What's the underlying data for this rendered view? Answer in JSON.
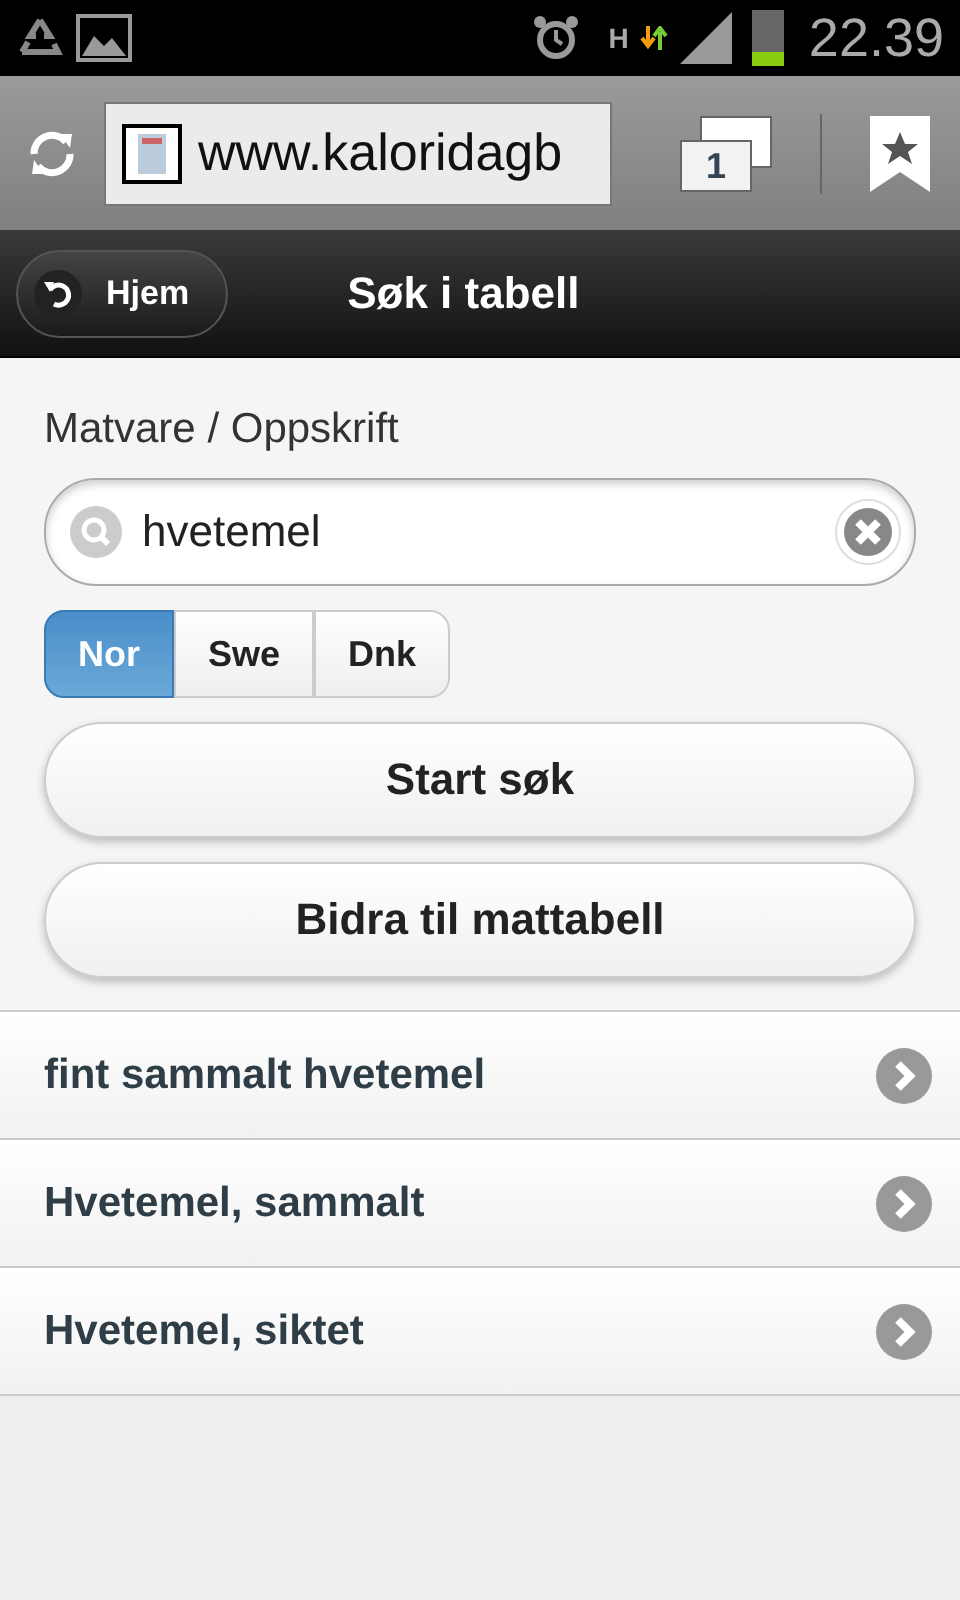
{
  "status_bar": {
    "network": "H",
    "time": "22.39"
  },
  "browser": {
    "url": "www.kaloridagb",
    "tab_count": "1"
  },
  "header": {
    "back": "Hjem",
    "title": "Søk i tabell"
  },
  "form": {
    "label": "Matvare / Oppskrift",
    "search": {
      "value": "hvetemel"
    },
    "segments": [
      {
        "label": "Nor",
        "selected": true
      },
      {
        "label": "Swe",
        "selected": false
      },
      {
        "label": "Dnk",
        "selected": false
      }
    ],
    "buttons": [
      "Start søk",
      "Bidra til mattabell"
    ]
  },
  "results": [
    {
      "label": "fint sammalt hvetemel"
    },
    {
      "label": "Hvetemel, sammalt"
    },
    {
      "label": "Hvetemel, siktet"
    }
  ]
}
